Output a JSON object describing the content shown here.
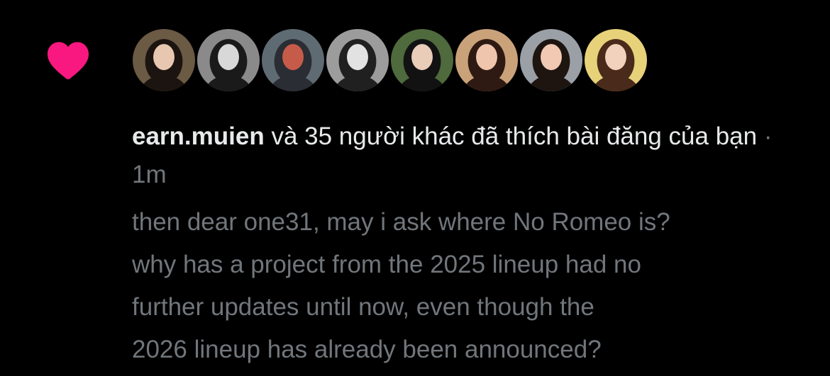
{
  "notification": {
    "type": "like",
    "heart_color": "#f91880",
    "avatars": [
      {
        "name": "avatar-1",
        "bg": "#6b5a44",
        "fg": "#1c1410",
        "face": "#e8c7b0"
      },
      {
        "name": "avatar-2",
        "bg": "#8a8a8a",
        "fg": "#1a1a1a",
        "face": "#d8d8d8"
      },
      {
        "name": "avatar-3",
        "bg": "#5f6b72",
        "fg": "#2a2d33",
        "face": "#c75b4a"
      },
      {
        "name": "avatar-4",
        "bg": "#9c9c9c",
        "fg": "#202020",
        "face": "#e2e2e2"
      },
      {
        "name": "avatar-5",
        "bg": "#4f6a3c",
        "fg": "#121212",
        "face": "#e9cdb9"
      },
      {
        "name": "avatar-6",
        "bg": "#c9a27a",
        "fg": "#2e1a12",
        "face": "#f0c5ad"
      },
      {
        "name": "avatar-7",
        "bg": "#9aa0a6",
        "fg": "#1e1510",
        "face": "#f2c9b2"
      },
      {
        "name": "avatar-8",
        "bg": "#e7d27a",
        "fg": "#4a2a1a",
        "face": "#f3d2bd"
      }
    ],
    "username": "earn.muien",
    "action_text": " và 35 người khác đã thích bài đăng của bạn",
    "separator": " · ",
    "time": "1m",
    "post_text": "then dear one31, may i ask where No Romeo is?\nwhy has a project from the 2025 lineup had no\nfurther updates until now, even though the\n2026 lineup has already been announced?"
  }
}
